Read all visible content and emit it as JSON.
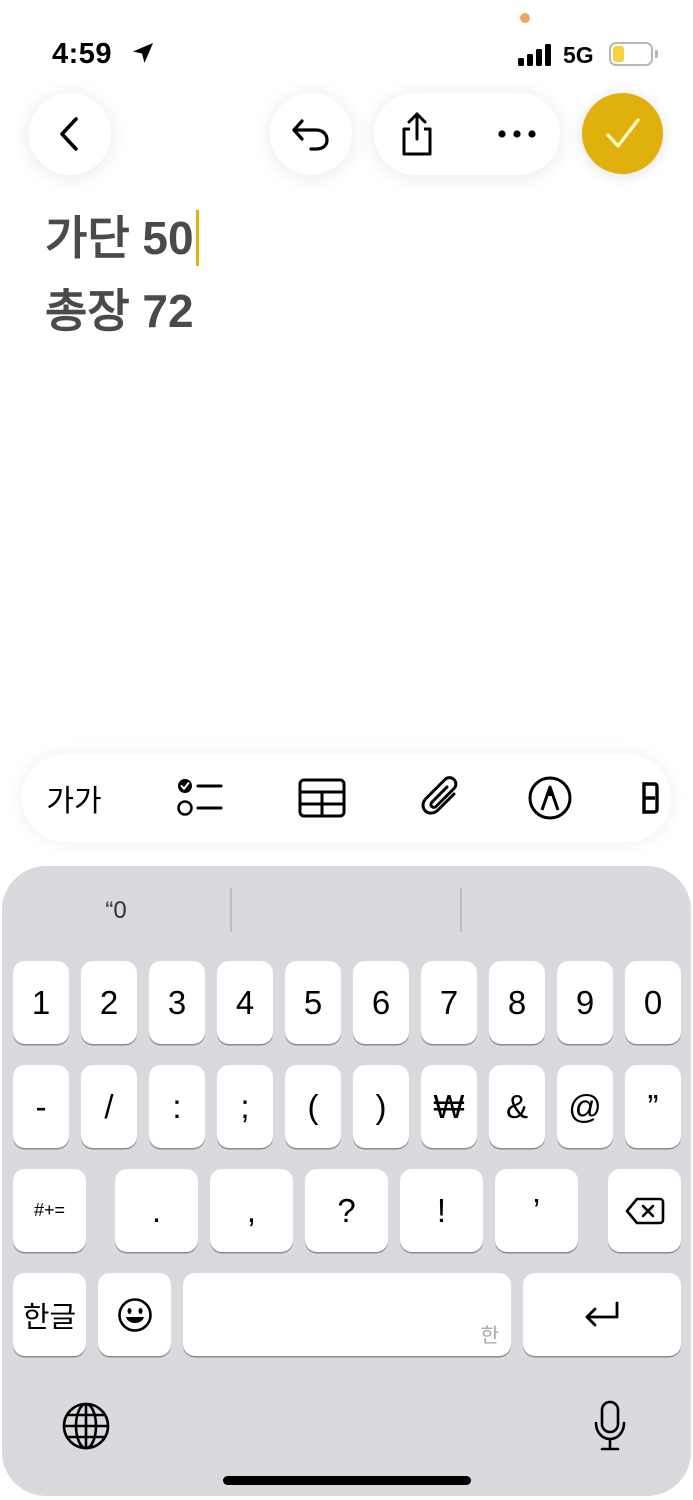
{
  "status_bar": {
    "time": "4:59",
    "network": "5G",
    "battery_level": 0.3,
    "battery_color": "#f5d33a",
    "location_icon": "location-arrow-icon"
  },
  "toolbar": {
    "back_icon": "chevron-left-icon",
    "undo_icon": "undo-icon",
    "share_icon": "share-icon",
    "more_icon": "ellipsis-icon",
    "done_icon": "checkmark-icon",
    "done_color": "#e0b00c"
  },
  "note": {
    "lines": [
      "가단 50",
      "총장 72"
    ]
  },
  "format_bar": {
    "text_style_label": "가가",
    "items": [
      "text-style",
      "checklist-icon",
      "table-icon",
      "paperclip-icon",
      "markup-pen-icon",
      "more-partial-icon"
    ]
  },
  "keyboard": {
    "suggestions": [
      "“0",
      "",
      ""
    ],
    "row1": [
      "1",
      "2",
      "3",
      "4",
      "5",
      "6",
      "7",
      "8",
      "9",
      "0"
    ],
    "row2": [
      "-",
      "/",
      ":",
      ";",
      "(",
      ")",
      "₩",
      "&",
      "@",
      "”"
    ],
    "row3": [
      "#+=",
      ".",
      ",",
      "?",
      "!",
      "’"
    ],
    "mode_key": "한글",
    "space_hint": "한",
    "emoji_icon": "emoji-icon",
    "delete_icon": "backspace-icon",
    "return_icon": "return-icon",
    "globe_icon": "globe-icon",
    "mic_icon": "microphone-icon"
  }
}
